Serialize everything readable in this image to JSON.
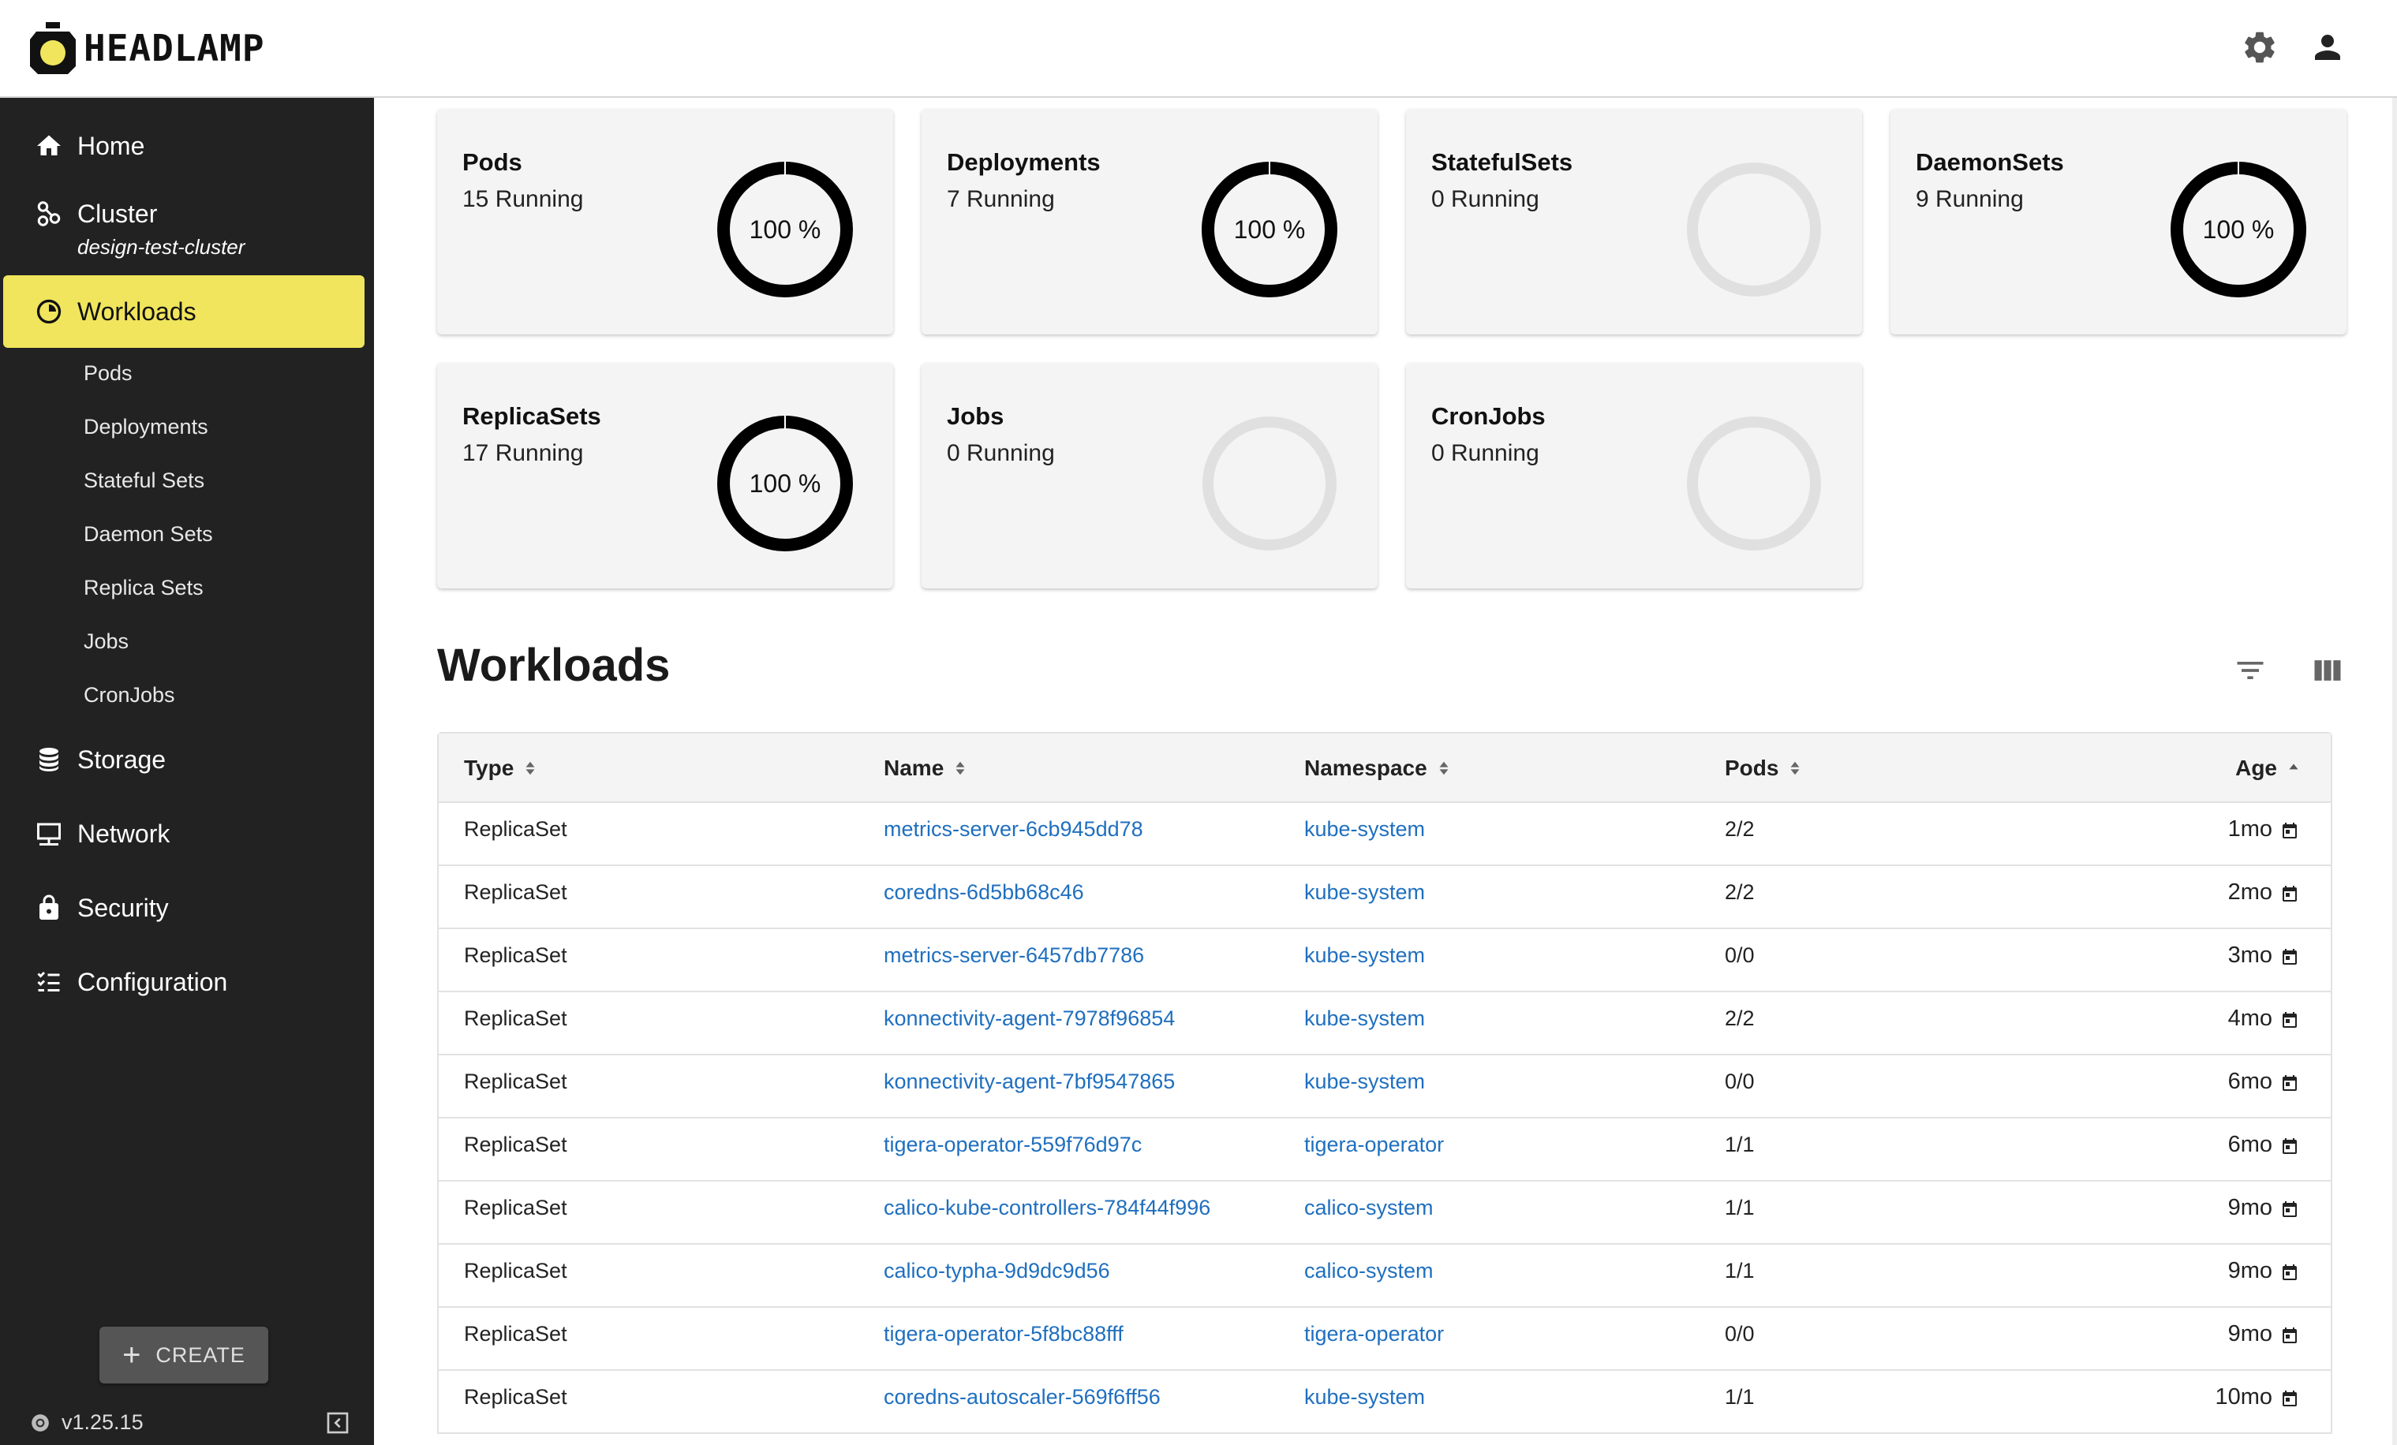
{
  "app": {
    "logo_text": "HEADLAMP"
  },
  "header": {
    "settings_icon": "gear-icon",
    "account_icon": "person-icon"
  },
  "sidebar": {
    "items": [
      {
        "label": "Home",
        "icon": "home-icon"
      },
      {
        "label": "Cluster",
        "icon": "cluster-icon",
        "sublabel": "design-test-cluster"
      },
      {
        "label": "Workloads",
        "icon": "workloads-icon",
        "active": true
      },
      {
        "label": "Storage",
        "icon": "storage-icon"
      },
      {
        "label": "Network",
        "icon": "network-icon"
      },
      {
        "label": "Security",
        "icon": "lock-icon"
      },
      {
        "label": "Configuration",
        "icon": "configuration-icon"
      }
    ],
    "subitems": [
      "Pods",
      "Deployments",
      "Stateful Sets",
      "Daemon Sets",
      "Replica Sets",
      "Jobs",
      "CronJobs"
    ],
    "create_label": "CREATE",
    "version": "v1.25.15",
    "active_color": "#f0e55c"
  },
  "cards": [
    {
      "title": "Pods",
      "sub": "15 Running",
      "percent_label": "100 %",
      "percent": 100
    },
    {
      "title": "Deployments",
      "sub": "7 Running",
      "percent_label": "100 %",
      "percent": 100
    },
    {
      "title": "StatefulSets",
      "sub": "0 Running",
      "percent_label": "",
      "percent": 0
    },
    {
      "title": "DaemonSets",
      "sub": "9 Running",
      "percent_label": "100 %",
      "percent": 100
    },
    {
      "title": "ReplicaSets",
      "sub": "17 Running",
      "percent_label": "100 %",
      "percent": 100
    },
    {
      "title": "Jobs",
      "sub": "0 Running",
      "percent_label": "",
      "percent": 0
    },
    {
      "title": "CronJobs",
      "sub": "0 Running",
      "percent_label": "",
      "percent": 0
    }
  ],
  "workloads": {
    "title": "Workloads",
    "filter_icon": "filter-icon",
    "columns_icon": "columns-icon",
    "columns": [
      "Type",
      "Name",
      "Namespace",
      "Pods",
      "Age"
    ],
    "link_color": "#1f6fbf",
    "rows": [
      {
        "type": "ReplicaSet",
        "name": "metrics-server-6cb945dd78",
        "namespace": "kube-system",
        "pods": "2/2",
        "age": "1mo"
      },
      {
        "type": "ReplicaSet",
        "name": "coredns-6d5bb68c46",
        "namespace": "kube-system",
        "pods": "2/2",
        "age": "2mo"
      },
      {
        "type": "ReplicaSet",
        "name": "metrics-server-6457db7786",
        "namespace": "kube-system",
        "pods": "0/0",
        "age": "3mo"
      },
      {
        "type": "ReplicaSet",
        "name": "konnectivity-agent-7978f96854",
        "namespace": "kube-system",
        "pods": "2/2",
        "age": "4mo"
      },
      {
        "type": "ReplicaSet",
        "name": "konnectivity-agent-7bf9547865",
        "namespace": "kube-system",
        "pods": "0/0",
        "age": "6mo"
      },
      {
        "type": "ReplicaSet",
        "name": "tigera-operator-559f76d97c",
        "namespace": "tigera-operator",
        "pods": "1/1",
        "age": "6mo"
      },
      {
        "type": "ReplicaSet",
        "name": "calico-kube-controllers-784f44f996",
        "namespace": "calico-system",
        "pods": "1/1",
        "age": "9mo"
      },
      {
        "type": "ReplicaSet",
        "name": "calico-typha-9d9dc9d56",
        "namespace": "calico-system",
        "pods": "1/1",
        "age": "9mo"
      },
      {
        "type": "ReplicaSet",
        "name": "tigera-operator-5f8bc88fff",
        "namespace": "tigera-operator",
        "pods": "0/0",
        "age": "9mo"
      },
      {
        "type": "ReplicaSet",
        "name": "coredns-autoscaler-569f6ff56",
        "namespace": "kube-system",
        "pods": "1/1",
        "age": "10mo"
      }
    ]
  }
}
